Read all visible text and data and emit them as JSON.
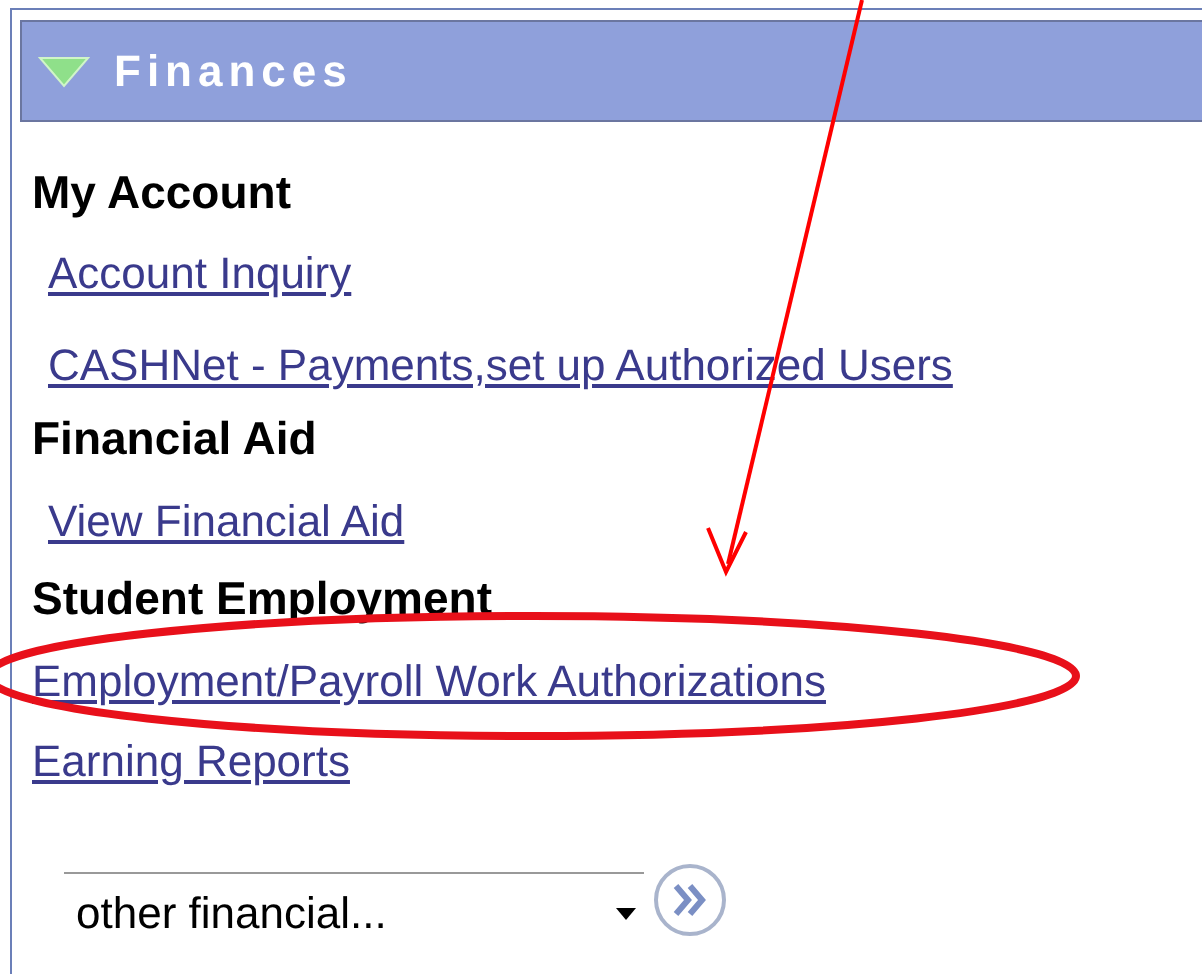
{
  "panel": {
    "title": "Finances",
    "expanded": true
  },
  "sections": [
    {
      "heading": "My Account",
      "links": [
        "Account Inquiry",
        "CASHNet - Payments,set up Authorized Users"
      ]
    },
    {
      "heading": "Financial Aid",
      "links": [
        "View Financial Aid"
      ]
    },
    {
      "heading": "Student Employment",
      "links": [
        "Employment/Payroll Work Authorizations",
        "Earning Reports"
      ]
    }
  ],
  "dropdown": {
    "value": "other financial..."
  }
}
